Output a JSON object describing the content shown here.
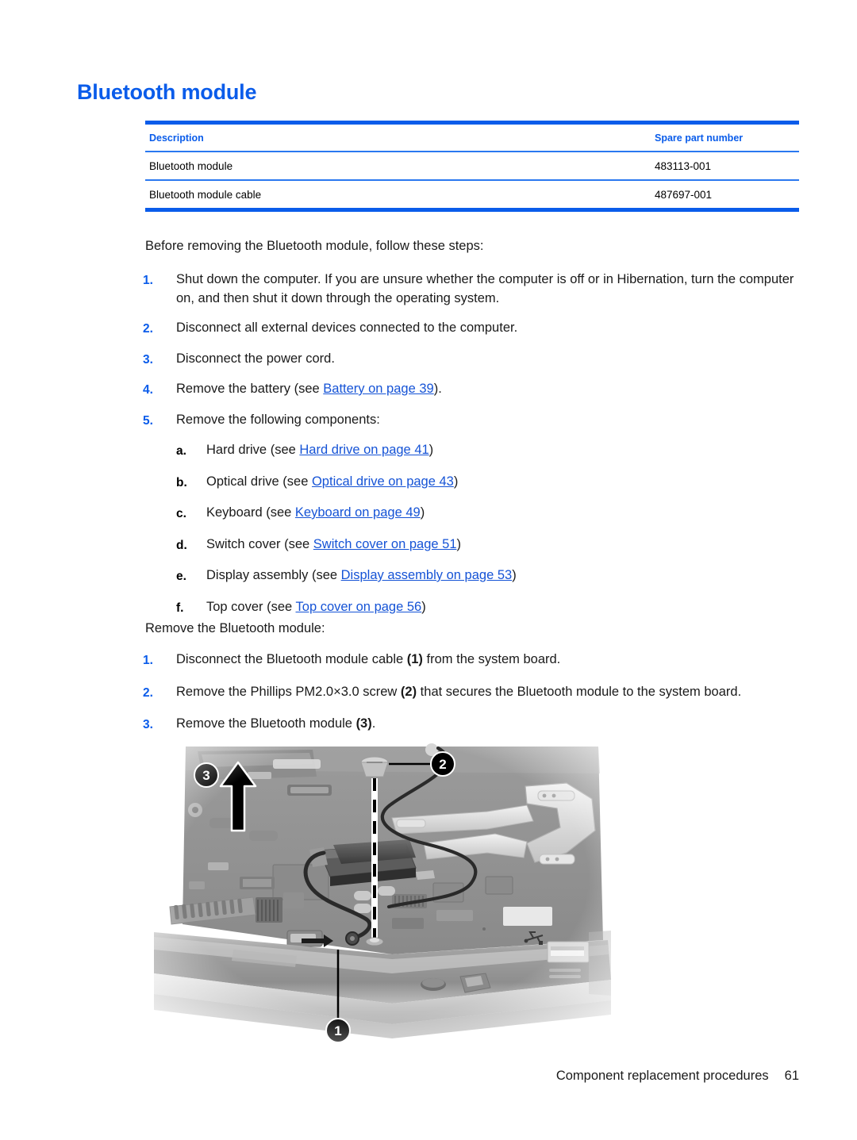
{
  "heading": "Bluetooth module",
  "parts_table": {
    "columns": [
      "Description",
      "Spare part number"
    ],
    "rows": [
      {
        "description": "Bluetooth module",
        "part_number": "483113-001"
      },
      {
        "description": "Bluetooth module cable",
        "part_number": "487697-001"
      }
    ]
  },
  "prep": {
    "lead": "Before removing the Bluetooth module, follow these steps:",
    "steps": [
      {
        "num": "1.",
        "text": "Shut down the computer. If you are unsure whether the computer is off or in Hibernation, turn the computer on, and then shut it down through the operating system."
      },
      {
        "num": "2.",
        "text": "Disconnect all external devices connected to the computer."
      },
      {
        "num": "3.",
        "text": "Disconnect the power cord."
      },
      {
        "num": "4.",
        "pre": "Remove the battery (see ",
        "link": "Battery on page 39",
        "post": ")."
      },
      {
        "num": "5.",
        "text": "Remove the following components:"
      }
    ],
    "substeps": [
      {
        "letter": "a.",
        "pre": "Hard drive (see ",
        "link": "Hard drive on page 41",
        "post": ")"
      },
      {
        "letter": "b.",
        "pre": "Optical drive (see ",
        "link": "Optical drive on page 43",
        "post": ")"
      },
      {
        "letter": "c.",
        "pre": "Keyboard (see ",
        "link": "Keyboard on page 49",
        "post": ")"
      },
      {
        "letter": "d.",
        "pre": "Switch cover (see ",
        "link": "Switch cover on page 51",
        "post": ")"
      },
      {
        "letter": "e.",
        "pre": "Display assembly (see ",
        "link": "Display assembly on page 53",
        "post": ")"
      },
      {
        "letter": "f.",
        "pre": "Top cover (see ",
        "link": "Top cover on page 56",
        "post": ")"
      }
    ]
  },
  "removal": {
    "lead": "Remove the Bluetooth module:",
    "steps": [
      {
        "num": "1.",
        "pre": "Disconnect the Bluetooth module cable ",
        "bold": "(1)",
        "post": " from the system board."
      },
      {
        "num": "2.",
        "pre": "Remove the Phillips PM2.0×3.0 screw ",
        "bold": "(2)",
        "post": " that secures the Bluetooth module to the system board."
      },
      {
        "num": "3.",
        "pre": "Remove the Bluetooth module ",
        "bold": "(3)",
        "post": "."
      }
    ]
  },
  "figure": {
    "description": "Photograph of laptop base enclosure showing Bluetooth module, cable and screw",
    "callouts": [
      {
        "id": "1",
        "meaning": "Bluetooth module cable connector on system board"
      },
      {
        "id": "2",
        "meaning": "Phillips PM2.0x3.0 screw"
      },
      {
        "id": "3",
        "meaning": "Bluetooth module removal direction"
      }
    ]
  },
  "footer": {
    "chapter": "Component replacement procedures",
    "page": "61"
  },
  "colors": {
    "accent": "#0a5cea",
    "link": "#1553d6",
    "text": "#1a1a1a"
  }
}
